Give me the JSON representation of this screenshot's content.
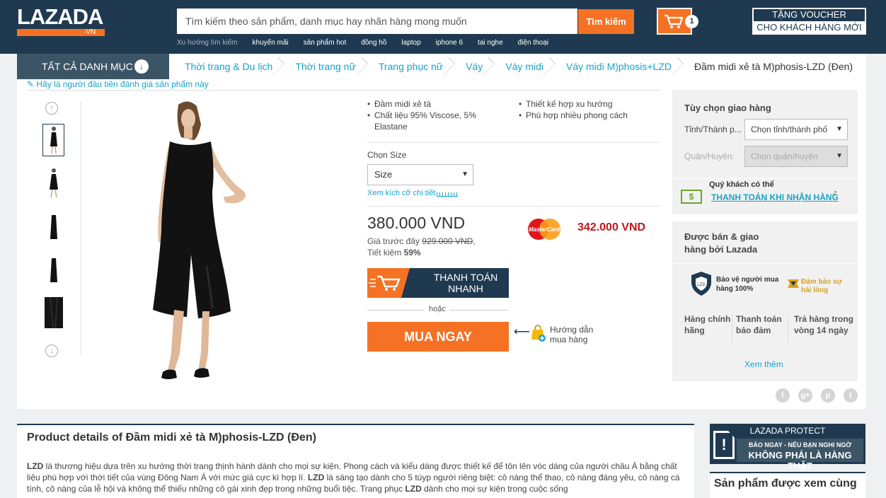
{
  "header": {
    "logo_text": "LAZADA",
    "logo_suffix": "·VN",
    "search_placeholder": "Tìm kiếm theo sản phẩm, danh mục hay nhãn hàng mong muốn",
    "search_button": "Tìm kiếm",
    "trending_label": "Xu hướng tìm kiếm",
    "trending": [
      "khuyến mãi",
      "sản phẩm hot",
      "đồng hồ",
      "laptop",
      "iphone 6",
      "tai nghe",
      "điện thoại"
    ],
    "cart_count": "1",
    "voucher_line1": "TẶNG VOUCHER",
    "voucher_line2": "CHO KHÁCH HÀNG MỚI",
    "brand_color": "#f57224",
    "header_color": "#1f3a50"
  },
  "nav": {
    "all_categories": "TẤT CẢ DANH MỤC",
    "breadcrumbs": [
      "Thời trang & Du lịch",
      "Thời trang nữ",
      "Trang phục nữ",
      "Váy",
      "Váy midi",
      "Váy midi M)phosis+LZD",
      "Đầm midi xẻ tà M)phosis-LZD (Đen)"
    ]
  },
  "product": {
    "first_review": "Hãy là người đầu tiên đánh giá sản phẩm này",
    "features_left": [
      "Đầm midi xẻ tà",
      "Chất liệu 95% Viscose, 5% Elastane"
    ],
    "features_right": [
      "Thiết kế hợp xu hướng",
      "Phù hợp nhiều phong cách"
    ],
    "size_label": "Chọn Size",
    "size_value": "Size",
    "size_chart": "Xem kích cỡ chi tiết",
    "price": "380.000 VND",
    "old_price_label": "Giá trước đây",
    "old_price": "929.000 VND",
    "saving_label": "Tiết kiệm",
    "saving": "59%",
    "card_price": "342.000 VND",
    "card_name": "MasterCard",
    "fast_pay": "THANH TOÁN NHANH",
    "or": "hoặc",
    "buy_now": "MUA NGAY",
    "guide": "Hướng dẫn mua hàng"
  },
  "delivery": {
    "title": "Tùy chọn giao hàng",
    "city_label": "Tỉnh/Thành p...",
    "city_select": "Chọn tỉnh/thành phố",
    "district_label": "Quận/Huyện:",
    "district_select": "Chọn quận/huyện",
    "cod_label": "Quý khách có thể",
    "cod_link": "THANH TOÁN KHI NHẬN HÀNG",
    "cod_icon_text": "$"
  },
  "sold": {
    "title": "Được bán & giao hàng bởi Lazada",
    "protect": "Bảo vệ người mua hàng 100%",
    "satisfaction": "Đảm bảo sự hài lòng",
    "benefits": [
      "Hàng chính hãng",
      "Thanh toán bảo đảm",
      "Trả hàng trong vòng 14 ngày"
    ],
    "see_more": "Xem thêm",
    "social": [
      "t",
      "g+",
      "p",
      "t"
    ]
  },
  "details": {
    "title": "Product details of Đầm midi xẻ tà M)phosis-LZD (Đen)",
    "brand": "LZD",
    "p1": " là thương hiệu dựa trên xu hướng thời trang thịnh hành dành cho mọi sự kiện. Phong cách và kiểu dáng được thiết kế để tôn lên vóc dáng của người châu Á bằng chất liệu phù hợp với thời tiết của vùng Đông Nam Á với mức giá cực kì hợp lí. ",
    "p2": " là sáng tạo dành cho 5 túyp người riêng biệt: cô nàng thể thao, cô nàng đáng yêu, cô nàng cá tính, cô nàng của lễ hội và không thể thiếu những cô gái xinh đẹp trong những buổi tiệc. Trang phục ",
    "p3": " dành cho mọi sự kiện trong cuộc sống"
  },
  "protect_banner": {
    "title": "LAZADA PROTECT",
    "small": "BÁO NGAY - NẾU BẠN NGHI NGỜ",
    "big": "KHÔNG PHẢI LÀ HÀNG THẬT"
  },
  "related": {
    "title": "Sản phẩm được xem cùng"
  }
}
